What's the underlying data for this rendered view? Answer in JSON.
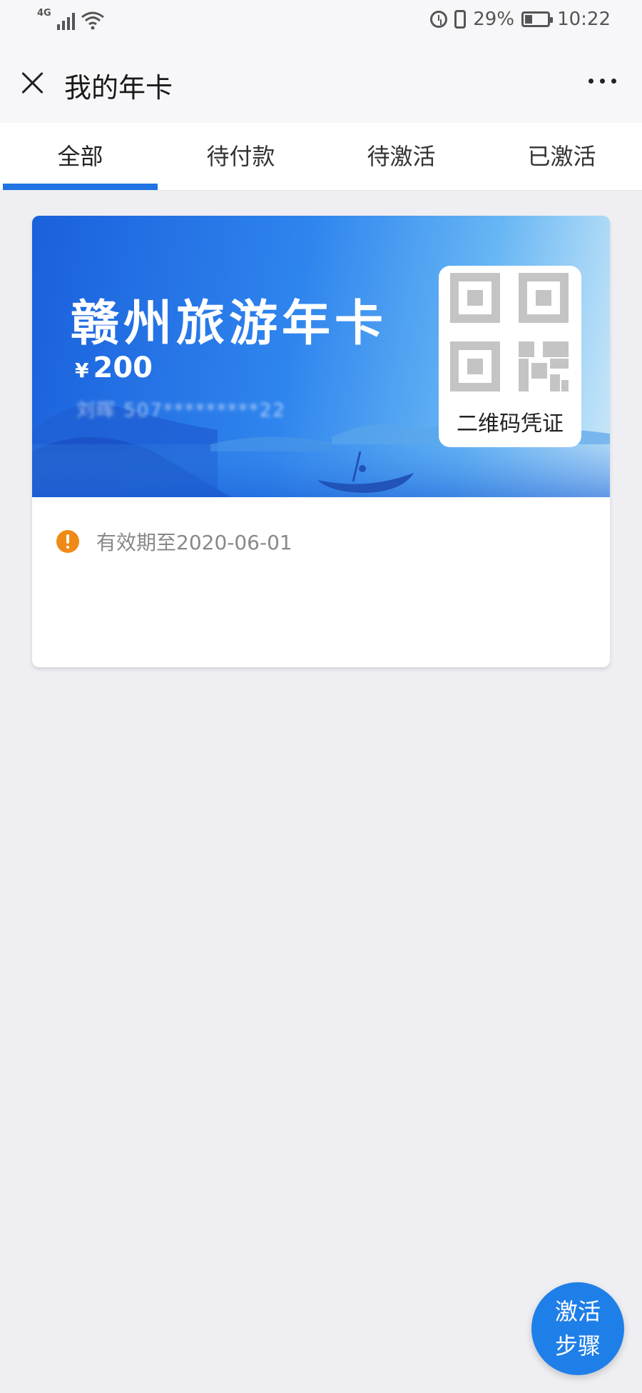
{
  "status_bar": {
    "network": "4G",
    "battery": "29%",
    "time": "10:22"
  },
  "header": {
    "title": "我的年卡",
    "close_icon": "close-icon",
    "more_icon": "more-icon"
  },
  "tabs": [
    {
      "label": "全部",
      "active": true
    },
    {
      "label": "待付款",
      "active": false
    },
    {
      "label": "待激活",
      "active": false
    },
    {
      "label": "已激活",
      "active": false
    }
  ],
  "card": {
    "title": "赣州旅游年卡",
    "price_symbol": "¥",
    "price": "200",
    "owner_masked": "刘晖   507*********22",
    "qr_label": "二维码凭证",
    "validity": "有效期至2020-06-01"
  },
  "fab": {
    "line1": "激活",
    "line2": "步骤"
  },
  "colors": {
    "accent": "#1f73e2",
    "warning": "#f08a17",
    "background": "#efeff3"
  }
}
